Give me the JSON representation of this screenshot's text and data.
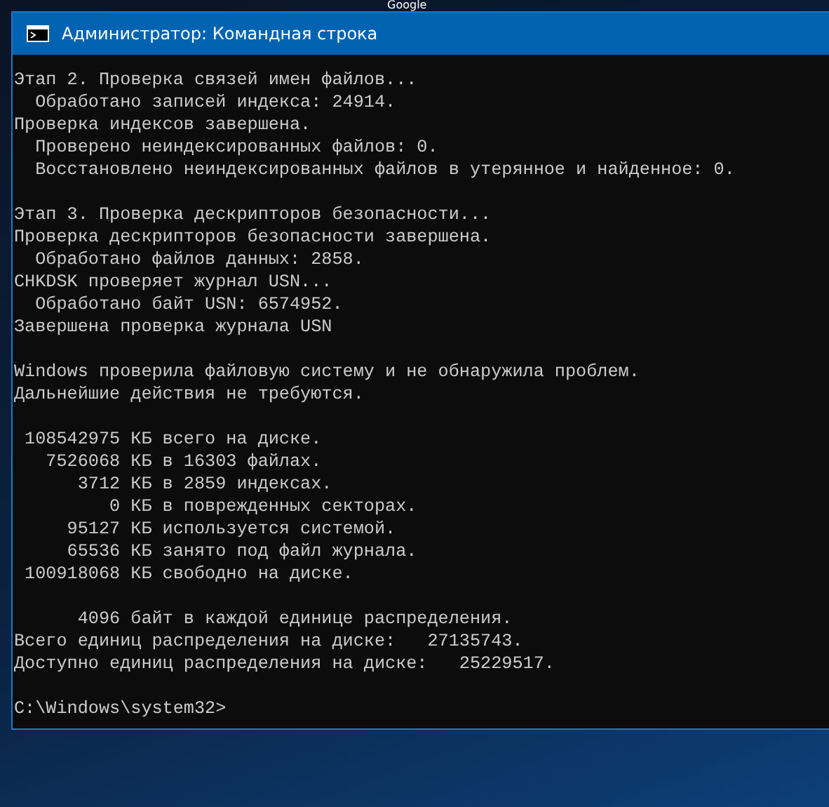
{
  "desktop": {
    "icon_label": "Google"
  },
  "window": {
    "title": "Администратор: Командная строка"
  },
  "console": {
    "blocks": [
      {
        "lines": [
          "Этап 2. Проверка связей имен файлов...",
          "  Обработано записей индекса: 24914.",
          "Проверка индексов завершена.",
          "  Проверено неиндексированных файлов: 0.",
          "  Восстановлено неиндексированных файлов в утерянное и найденное: 0."
        ]
      },
      {
        "lines": [
          "Этап 3. Проверка дескрипторов безопасности...",
          "Проверка дескрипторов безопасности завершена.",
          "  Обработано файлов данных: 2858.",
          "CHKDSK проверяет журнал USN...",
          "  Обработано байт USN: 6574952.",
          "Завершена проверка журнала USN"
        ]
      },
      {
        "lines": [
          "Windows проверила файловую систему и не обнаружила проблем.",
          "Дальнейшие действия не требуются."
        ]
      },
      {
        "lines": [
          " 108542975 КБ всего на диске.",
          "   7526068 КБ в 16303 файлах.",
          "      3712 КБ в 2859 индексах.",
          "         0 КБ в поврежденных секторах.",
          "     95127 КБ используется системой.",
          "     65536 КБ занято под файл журнала.",
          " 100918068 КБ свободно на диске."
        ]
      },
      {
        "lines": [
          "      4096 байт в каждой единице распределения.",
          "Всего единиц распределения на диске:   27135743.",
          "Доступно единиц распределения на диске:   25229517."
        ]
      },
      {
        "lines": [
          "C:\\Windows\\system32>"
        ]
      }
    ]
  }
}
